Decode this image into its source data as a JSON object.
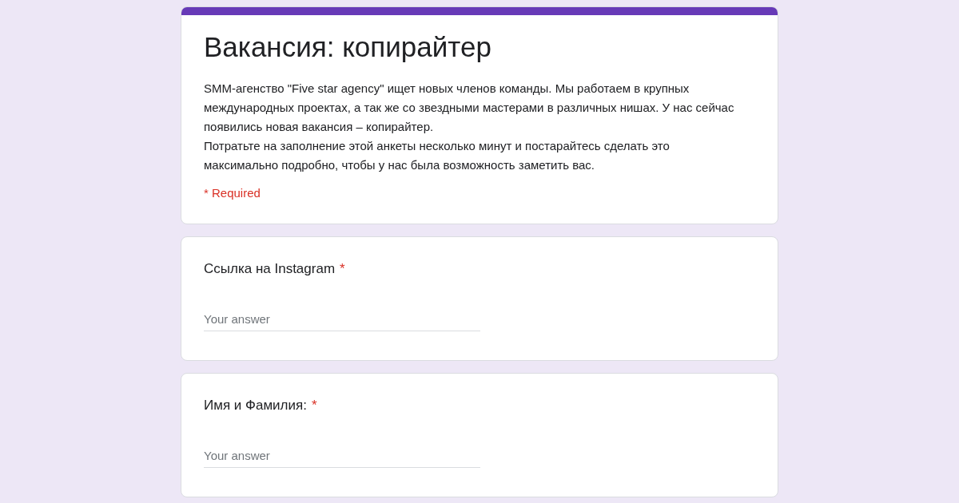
{
  "form": {
    "title": "Вакансия: копирайтер",
    "description": [
      "SMM-агенство  \"Five star agency\" ищет новых членов команды. Мы работаем в крупных международных проектах, а так же со звездными мастерами в различных нишах. У нас сейчас появились новая вакансия – копирайтер.",
      "Потратьте на заполнение этой анкеты несколько минут и постарайтесь сделать это максимально подробно, чтобы у нас была возможность заметить вас."
    ],
    "required_note": "* Required"
  },
  "questions": [
    {
      "label": "Ссылка на Instagram",
      "required_mark": "*",
      "placeholder": "Your answer"
    },
    {
      "label": "Имя и Фамилия:",
      "required_mark": "*",
      "placeholder": "Your answer"
    }
  ]
}
